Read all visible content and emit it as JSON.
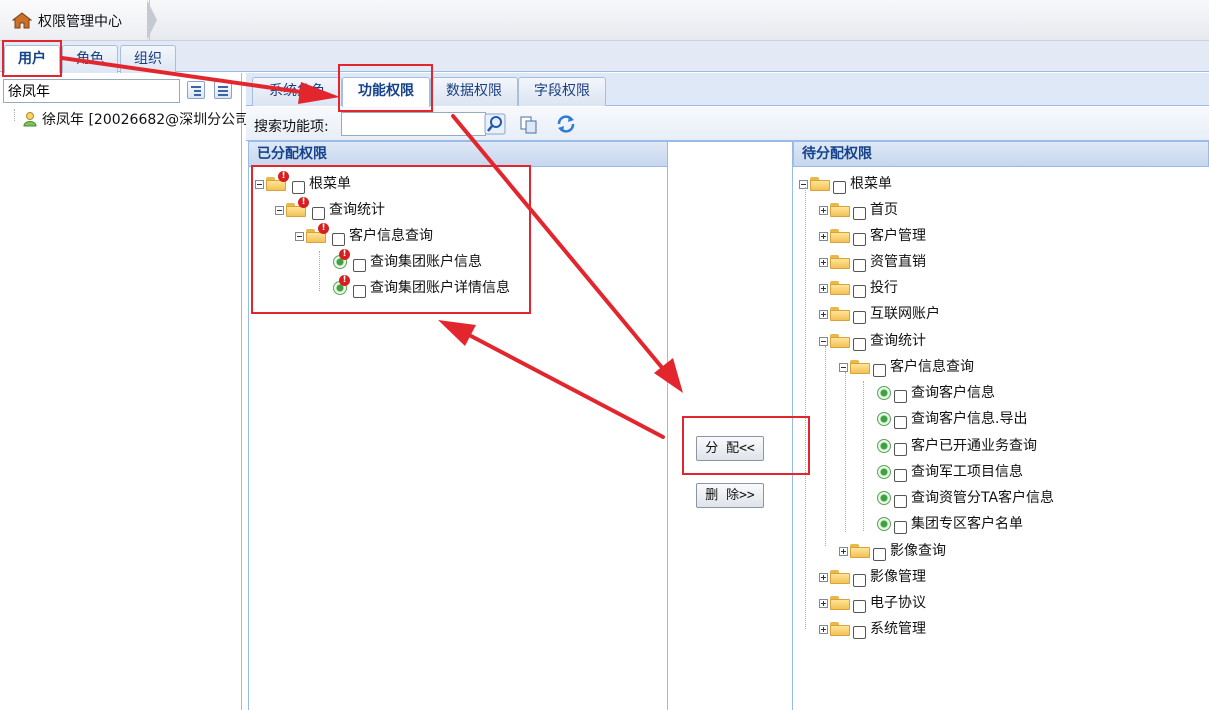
{
  "breadcrumb": {
    "title": "权限管理中心"
  },
  "top_tabs": [
    {
      "label": "用户",
      "active": true
    },
    {
      "label": "角色",
      "active": false
    },
    {
      "label": "组织",
      "active": false
    }
  ],
  "left": {
    "search_value": "徐凤年",
    "user_node": "徐凤年 [20026682@深圳分公司"
  },
  "right_tabs": [
    {
      "label": "系统角色",
      "active": false
    },
    {
      "label": "功能权限",
      "active": true
    },
    {
      "label": "数据权限",
      "active": false
    },
    {
      "label": "字段权限",
      "active": false
    }
  ],
  "search": {
    "label": "搜索功能项:",
    "value": ""
  },
  "assigned": {
    "header": "已分配权限",
    "nodes": [
      "根菜单",
      "查询统计",
      "客户信息查询",
      "查询集团账户信息",
      "查询集团账户详情信息"
    ]
  },
  "buttons": {
    "assign": "分 配<<",
    "delete": "删 除>>"
  },
  "pending": {
    "header": "待分配权限",
    "nodes": [
      "根菜单",
      "首页",
      "客户管理",
      "资管直销",
      "投行",
      "互联网账户",
      "查询统计",
      "客户信息查询",
      "查询客户信息",
      "查询客户信息.导出",
      "客户已开通业务查询",
      "查询军工项目信息",
      "查询资管分TA客户信息",
      "集团专区客户名单",
      "影像查询",
      "影像管理",
      "电子协议",
      "系统管理"
    ]
  },
  "colors": {
    "accent": "#15428b",
    "annotation_red": "#e3262e"
  }
}
